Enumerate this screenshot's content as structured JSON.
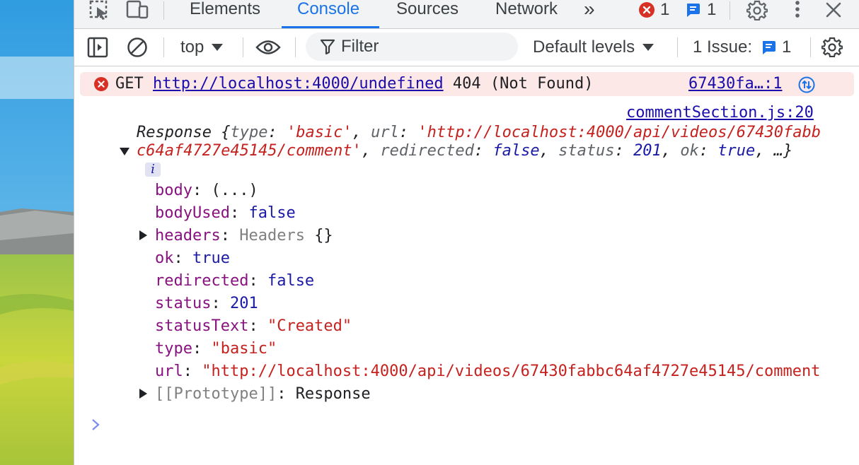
{
  "tabs": {
    "elements": "Elements",
    "console": "Console",
    "sources": "Sources",
    "network": "Network",
    "more": "»"
  },
  "badges": {
    "errors": "1",
    "messages": "1"
  },
  "toolbar": {
    "context": "top",
    "filter_placeholder": "Filter",
    "levels": "Default levels",
    "issues_label": "1 Issue:",
    "issues_count": "1"
  },
  "error": {
    "method": "GET",
    "url": "http://localhost:4000/undefined",
    "status": "404 (Not Found)",
    "source": "67430fa…:1"
  },
  "log": {
    "source": "commentSection.js:20",
    "summary": {
      "name": "Response",
      "type_key": "type",
      "type_val": "'basic'",
      "url_key": "url",
      "url_val_part1": "'http://localhost:4000/api/videos/67430fabb",
      "url_val_part2": "c64af4727e45145/comment'",
      "redirected_key": "redirected",
      "redirected_val": "false",
      "status_key": "status",
      "status_val": "201",
      "ok_key": "ok",
      "ok_val": "true",
      "ellipsis": "…}"
    },
    "info": "i",
    "props": [
      {
        "key": "body",
        "val": "(...)",
        "cls": "plain"
      },
      {
        "key": "bodyUsed",
        "val": "false",
        "cls": "kw"
      },
      {
        "key": "headers",
        "val": "Headers",
        "extra": "{}",
        "cls": "gray",
        "expandable": true
      },
      {
        "key": "ok",
        "val": "true",
        "cls": "kw"
      },
      {
        "key": "redirected",
        "val": "false",
        "cls": "kw"
      },
      {
        "key": "status",
        "val": "201",
        "cls": "num"
      },
      {
        "key": "statusText",
        "val": "\"Created\"",
        "cls": "str"
      },
      {
        "key": "type",
        "val": "\"basic\"",
        "cls": "str"
      },
      {
        "key": "url",
        "val": "\"http://localhost:4000/api/videos/67430fabbc64af4727e45145/comment'",
        "cls": "str"
      },
      {
        "key": "[[Prototype]]",
        "val": "Response",
        "cls": "plain",
        "expandable": true
      }
    ]
  },
  "colors": {
    "accent": "#1a73e8",
    "error_bg": "#fce8e6",
    "error_icon": "#d93025",
    "string": "#c5221f",
    "keyword": "#1a1aa6",
    "property": "#881280"
  }
}
